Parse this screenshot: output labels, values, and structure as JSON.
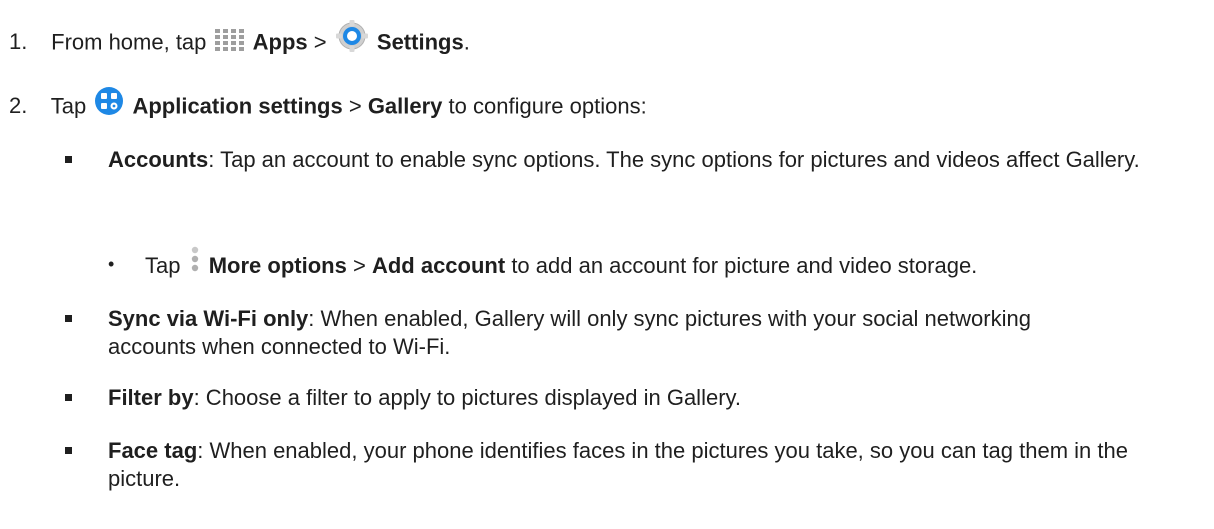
{
  "step1": {
    "number": "1.",
    "pre": "From home, tap",
    "apps": "Apps",
    "sep": ">",
    "settings": "Settings",
    "end": ".",
    "apps_icon": "apps-grid-icon",
    "settings_icon": "settings-gear-icon"
  },
  "step2": {
    "number": "2.",
    "pre": "Tap",
    "app_settings": "Application settings",
    "sep": ">",
    "gallery": "Gallery",
    "post": "to configure options:",
    "icon": "application-settings-icon",
    "icon_color": "#1e88e5"
  },
  "options": [
    {
      "term": "Accounts",
      "text": ": Tap an account to enable sync options. The sync options for pictures and videos affect Gallery."
    },
    {
      "term": "Sync via Wi-Fi only",
      "text": ": When enabled, Gallery will only sync pictures with your social networking accounts when connected to Wi-Fi."
    },
    {
      "term": "Filter by",
      "text": ": Choose a filter to apply to pictures displayed in Gallery."
    },
    {
      "term": "Face tag",
      "text": ": When enabled, your phone identifies faces in the pictures you take, so you can tag them in the picture."
    }
  ],
  "sub": {
    "pre": "Tap",
    "more": "More options",
    "sep": ">",
    "add": "Add account",
    "post": "to add an account for picture and video storage.",
    "icon": "more-options-icon"
  }
}
